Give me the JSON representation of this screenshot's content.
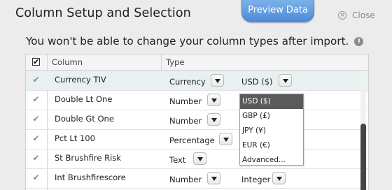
{
  "dialog": {
    "title": "Column Setup and Selection",
    "preview_label": "Preview Data",
    "close_label": "Close",
    "close_glyph": "×",
    "subtitle": "You won't be able to change your column types after import.",
    "info_glyph": "i"
  },
  "table": {
    "headers": {
      "column": "Column",
      "type": "Type"
    },
    "check_glyph": "✔",
    "rows": [
      {
        "name": "Currency TIV",
        "type": "Currency",
        "format": "USD ($)",
        "selected": true
      },
      {
        "name": "Double Lt One",
        "type": "Number",
        "format": ""
      },
      {
        "name": "Double Gt One",
        "type": "Number",
        "format": ""
      },
      {
        "name": "Pct Lt 100",
        "type": "Percentage",
        "format": ""
      },
      {
        "name": "St Brushfire Risk",
        "type": "Text",
        "format": ""
      },
      {
        "name": "Int Brushfirescore",
        "type": "Number",
        "format": "Integer"
      }
    ]
  },
  "currency_menu": {
    "options": [
      "USD ($)",
      "GBP (£)",
      "JPY (¥)",
      "EUR (€)",
      "Advanced..."
    ],
    "selected": "USD ($)"
  },
  "colors": {
    "preview_button": "#5b95db",
    "selected_row": "#e9f0f2",
    "menu_highlight": "#5a5a5a",
    "scroll_thumb": "#444444"
  }
}
